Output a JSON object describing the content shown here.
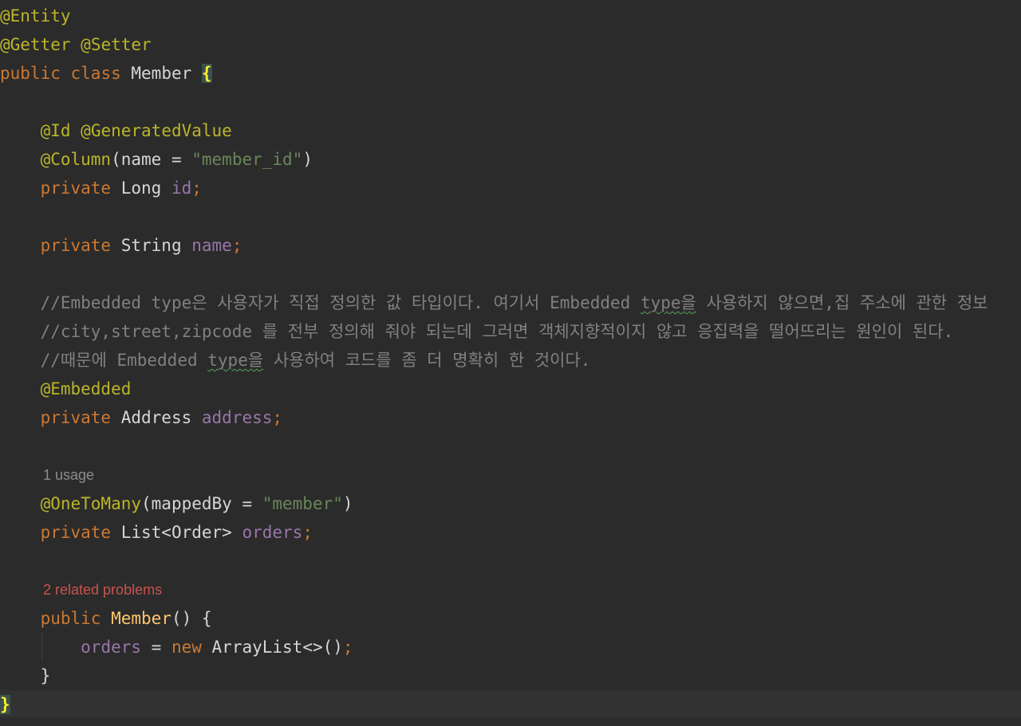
{
  "code": {
    "l1": {
      "ann": "@Entity"
    },
    "l2": {
      "ann1": "@Getter",
      "sp": " ",
      "ann2": "@Setter"
    },
    "l3": {
      "kw1": "public",
      "sp1": " ",
      "kw2": "class",
      "sp2": " ",
      "name": "Member",
      "sp3": " ",
      "brace": "{"
    },
    "l5": {
      "indent": "    ",
      "ann1": "@Id",
      "sp": " ",
      "ann2": "@GeneratedValue"
    },
    "l6": {
      "indent": "    ",
      "ann": "@Column",
      "open": "(name = ",
      "str": "\"member_id\"",
      "close": ")"
    },
    "l7": {
      "indent": "    ",
      "kw": "private",
      "type": " Long ",
      "fld": "id",
      "semi": ";"
    },
    "l9": {
      "indent": "    ",
      "kw": "private",
      "type": " String ",
      "fld": "name",
      "semi": ";"
    },
    "l11": {
      "indent": "    ",
      "c1": "//Embedded ",
      "sq": "type",
      "c2": "은 사용자가 직접 정의한 값 타입이다. 여기서 Embedded ",
      "sq2": "type을",
      "c3": " 사용하지 않으면,집 주소에 관한 정보"
    },
    "l12": {
      "indent": "    ",
      "c": "//city,street,zipcode 를 전부 정의해 줘야 되는데 그러면 객체지향적이지 않고 응집력을 떨어뜨리는 원인이 된다."
    },
    "l13": {
      "indent": "    ",
      "c1": "//때문에 Embedded ",
      "sq": "type을",
      "c2": " 사용하여 코드를 좀 더 명확히 한 것이다."
    },
    "l14": {
      "indent": "    ",
      "ann": "@Embedded"
    },
    "l15": {
      "indent": "    ",
      "kw": "private",
      "type": " Address ",
      "fld": "address",
      "semi": ";"
    },
    "hint1": {
      "text": "1 usage"
    },
    "l17": {
      "indent": "    ",
      "ann": "@OneToMany",
      "open": "(mappedBy = ",
      "str": "\"member\"",
      "close": ")"
    },
    "l18": {
      "indent": "    ",
      "kw": "private",
      "type": " List<Order> ",
      "fld": "orders",
      "semi": ";"
    },
    "hint2": {
      "text": "2 related problems"
    },
    "l20": {
      "indent": "    ",
      "kw": "public",
      "sp": " ",
      "fn": "Member",
      "rest": "() {"
    },
    "l21": {
      "indent": "        ",
      "fld": "orders",
      "eq": " = ",
      "kw": "new",
      "rest": " ArrayList<>()",
      "semi": ";"
    },
    "l22": {
      "indent": "    ",
      "brace": "}"
    },
    "l23": {
      "brace": "}"
    }
  },
  "colors": {
    "background": "#2b2b2b",
    "annotation": "#bbb529",
    "keyword": "#cc7832",
    "string": "#6a8759",
    "field": "#9876aa",
    "comment": "#808080",
    "method": "#ffc66d",
    "problem_hint": "#c7544f"
  }
}
